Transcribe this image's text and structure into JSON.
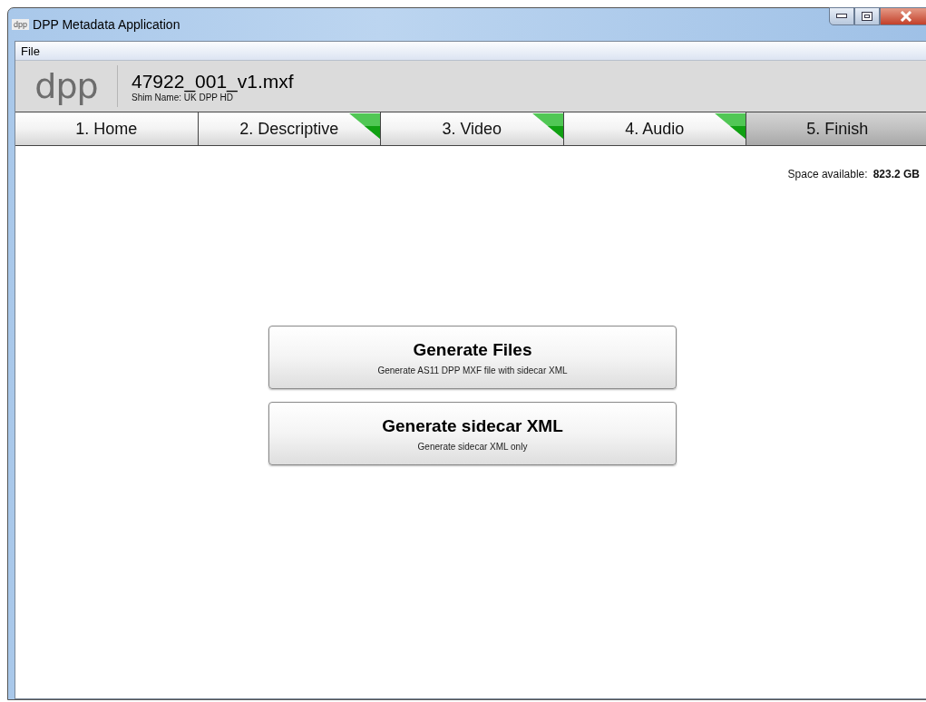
{
  "window": {
    "icon_text": "dpp",
    "title": "DPP Metadata Application"
  },
  "menu": [
    "File"
  ],
  "header": {
    "logo": "dpp",
    "file_name": "47922_001_v1.mxf",
    "shim": "Shim Name: UK DPP HD"
  },
  "tabs": [
    {
      "label": "1. Home",
      "selected": false,
      "complete": false
    },
    {
      "label": "2. Descriptive",
      "selected": false,
      "complete": true
    },
    {
      "label": "3. Video",
      "selected": false,
      "complete": true
    },
    {
      "label": "4. Audio",
      "selected": false,
      "complete": true
    },
    {
      "label": "5. Finish",
      "selected": true,
      "complete": false
    }
  ],
  "space": {
    "label": "Space available:",
    "value": "823.2 GB"
  },
  "actions": [
    {
      "title": "Generate Files",
      "subtitle": "Generate AS11 DPP MXF file with sidecar XML"
    },
    {
      "title": "Generate sidecar XML",
      "subtitle": "Generate sidecar XML only"
    }
  ]
}
